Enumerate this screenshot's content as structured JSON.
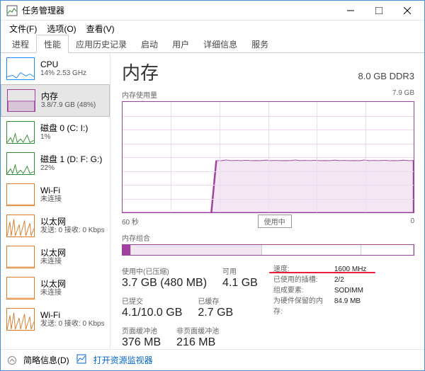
{
  "window": {
    "title": "任务管理器"
  },
  "menubar": [
    "文件(F)",
    "选项(O)",
    "查看(V)"
  ],
  "tabs": [
    "进程",
    "性能",
    "应用历史记录",
    "启动",
    "用户",
    "详细信息",
    "服务"
  ],
  "active_tab": 1,
  "sidebar": [
    {
      "name": "CPU",
      "sub": "14% 2.53 GHz",
      "color": "#1a8cff"
    },
    {
      "name": "内存",
      "sub": "3.8/7.9 GB (48%)",
      "color": "#a040a0",
      "selected": true
    },
    {
      "name": "磁盘 0 (C: I:)",
      "sub": "1%",
      "color": "#2e8b2e"
    },
    {
      "name": "磁盘 1 (D: F: G:)",
      "sub": "22%",
      "color": "#2e8b2e"
    },
    {
      "name": "Wi-Fi",
      "sub": "未连接",
      "color": "#d97b29"
    },
    {
      "name": "以太网",
      "sub": "发送: 0 接收: 0 Kbps",
      "color": "#d97b29"
    },
    {
      "name": "以太网",
      "sub": "未连接",
      "color": "#d97b29"
    },
    {
      "name": "以太网",
      "sub": "未连接",
      "color": "#d97b29"
    },
    {
      "name": "Wi-Fi",
      "sub": "发送: 0 接收: 0 Kbps",
      "color": "#d97b29"
    }
  ],
  "content": {
    "title": "内存",
    "subtitle": "8.0 GB DDR3",
    "usage_label": "内存使用量",
    "usage_max": "7.9 GB",
    "axis_left": "60 秒",
    "axis_right": "0",
    "inuse_badge": "使用中",
    "composition_label": "内存组合",
    "stats_row1": [
      {
        "label": "使用中(已压缩)",
        "value": "3.7 GB (480 MB)"
      },
      {
        "label": "可用",
        "value": "4.1 GB"
      }
    ],
    "stats_row2": [
      {
        "label": "已提交",
        "value": "4.1/10.0 GB"
      },
      {
        "label": "已缓存",
        "value": "2.7 GB"
      }
    ],
    "stats_row3": [
      {
        "label": "页面缓冲池",
        "value": "376 MB"
      },
      {
        "label": "非页面缓冲池",
        "value": "216 MB"
      }
    ],
    "details": [
      {
        "k": "速度:",
        "v": "1600 MHz",
        "highlight": true
      },
      {
        "k": "已使用的插槽:",
        "v": "2/2"
      },
      {
        "k": "组成要素:",
        "v": "SODIMM"
      },
      {
        "k": "为硬件保留的内存:",
        "v": "84.9 MB"
      }
    ]
  },
  "chart_data": {
    "type": "area",
    "title": "内存使用量",
    "xlabel": "60 秒",
    "ylabel": "",
    "ylim": [
      0,
      7.9
    ],
    "y_unit": "GB",
    "x_range_seconds": 60,
    "series": [
      {
        "name": "内存使用量",
        "values": [
          0,
          0,
          0,
          0,
          0,
          0,
          0,
          0,
          0,
          0,
          0,
          0,
          0,
          0,
          0,
          0,
          0,
          0,
          0,
          3.7,
          3.7,
          3.75,
          3.7,
          3.72,
          3.7,
          3.73,
          3.7,
          3.71,
          3.7,
          3.74,
          3.7,
          3.72,
          3.7,
          3.71,
          3.7,
          3.75,
          3.7,
          3.72,
          3.7,
          3.73,
          3.7,
          3.71,
          3.7,
          3.74,
          3.7,
          3.72,
          3.7,
          3.71,
          3.7,
          3.75,
          3.7,
          3.72,
          3.7,
          3.73,
          3.7,
          3.71,
          3.7,
          3.74,
          3.7,
          3.72
        ]
      }
    ]
  },
  "composition_data": {
    "segments_pct": [
      3,
      45,
      34,
      18
    ]
  },
  "footer": {
    "brief": "简略信息(D)",
    "link": "打开资源监视器"
  }
}
